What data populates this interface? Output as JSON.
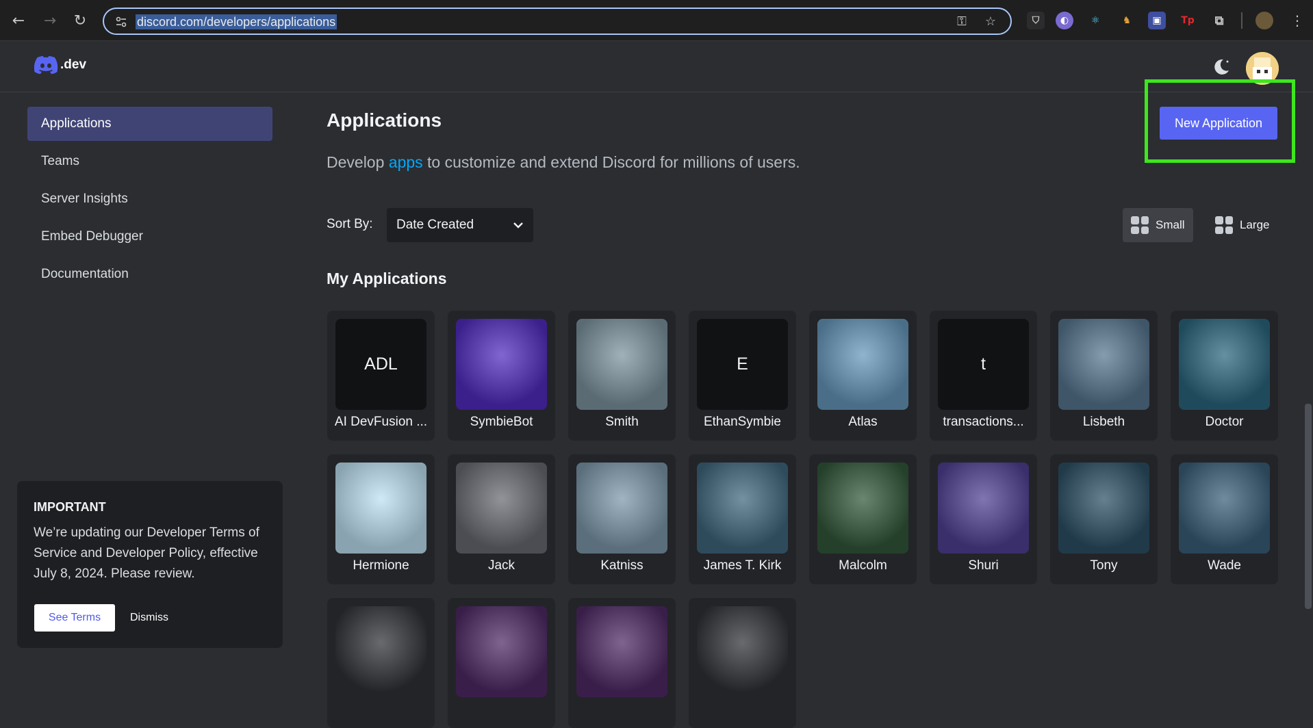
{
  "browser": {
    "url": "discord.com/developers/applications"
  },
  "header": {
    "logo_text": ".dev",
    "theme_icon": "moon-icon",
    "colors": {
      "accent": "#5865f2",
      "active_bg": "#404475",
      "highlight": "#3ee61e"
    }
  },
  "sidebar": {
    "items": [
      {
        "label": "Applications",
        "active": true
      },
      {
        "label": "Teams",
        "active": false
      },
      {
        "label": "Server Insights",
        "active": false
      },
      {
        "label": "Embed Debugger",
        "active": false
      },
      {
        "label": "Documentation",
        "active": false
      }
    ],
    "notice": {
      "title": "IMPORTANT",
      "body": "We’re updating our Developer Terms of Service and Developer Policy, effective July 8, 2024. Please review.",
      "see_terms": "See Terms",
      "dismiss": "Dismiss"
    }
  },
  "main": {
    "title": "Applications",
    "subtitle_pre": "Develop ",
    "subtitle_link": "apps",
    "subtitle_post": " to customize and extend Discord for millions of users.",
    "new_app_label": "New Application",
    "sort_label": "Sort By:",
    "sort_value": "Date Created",
    "view_small": "Small",
    "view_large": "Large",
    "section_title": "My Applications",
    "apps": [
      {
        "name": "AI DevFusion ...",
        "initials": "ADL",
        "color": "#111214"
      },
      {
        "name": "SymbieBot",
        "initials": "",
        "color": "#3b1f8a"
      },
      {
        "name": "Smith",
        "initials": "",
        "color": "#5a6b74"
      },
      {
        "name": "EthanSymbie",
        "initials": "E",
        "color": "#111214"
      },
      {
        "name": "Atlas",
        "initials": "",
        "color": "#4a6e88"
      },
      {
        "name": "transactions...",
        "initials": "t",
        "color": "#111214"
      },
      {
        "name": "Lisbeth",
        "initials": "",
        "color": "#3f5568"
      },
      {
        "name": "Doctor",
        "initials": "",
        "color": "#1f4a5c"
      },
      {
        "name": "Hermione",
        "initials": "",
        "color": "#8aa3b0"
      },
      {
        "name": "Jack",
        "initials": "",
        "color": "#4b4d52"
      },
      {
        "name": "Katniss",
        "initials": "",
        "color": "#5a6e7b"
      },
      {
        "name": "James T. Kirk",
        "initials": "",
        "color": "#2e4b5c"
      },
      {
        "name": "Malcolm",
        "initials": "",
        "color": "#24402a"
      },
      {
        "name": "Shuri",
        "initials": "",
        "color": "#3a2e6b"
      },
      {
        "name": "Tony",
        "initials": "",
        "color": "#203a4a"
      },
      {
        "name": "Wade",
        "initials": "",
        "color": "#2a4458"
      },
      {
        "name": "",
        "initials": "",
        "color": "#232428"
      },
      {
        "name": "",
        "initials": "",
        "color": "#3a1e4a"
      },
      {
        "name": "",
        "initials": "",
        "color": "#3a1e4a"
      },
      {
        "name": "",
        "initials": "",
        "color": "#232428"
      }
    ]
  }
}
